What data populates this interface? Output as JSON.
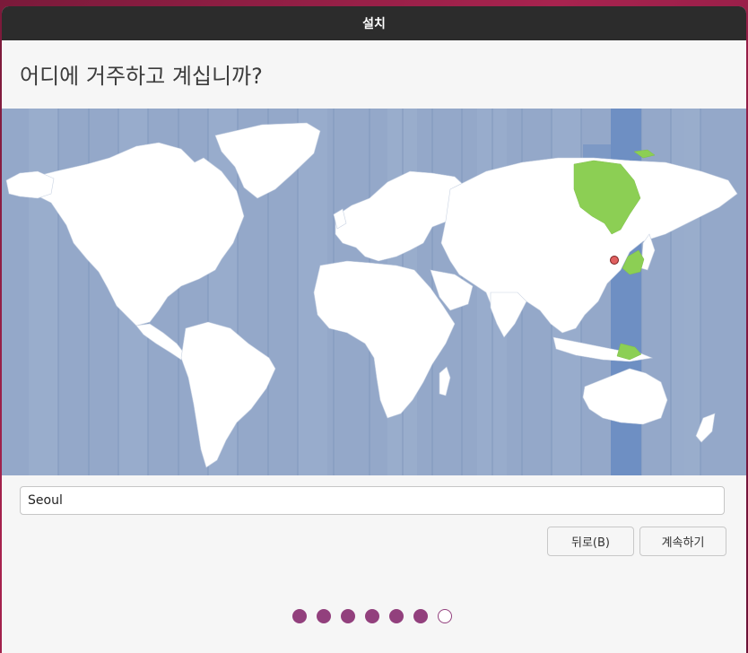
{
  "window": {
    "title": "설치"
  },
  "page": {
    "heading": "어디에 거주하고 계십니까?"
  },
  "timezone": {
    "city_value": "Seoul",
    "selected_zone": "Asia/Seoul"
  },
  "buttons": {
    "back_label": "뒤로(B)",
    "continue_label": "계속하기"
  },
  "progress": {
    "total_steps": 7,
    "current_step": 7
  },
  "colors": {
    "ocean": "#94a8c9",
    "land": "#ffffff",
    "selected_band": "#6e8fc3",
    "selected_land": "#8ccf54",
    "marker": "#e06060",
    "accent": "#92407d"
  }
}
